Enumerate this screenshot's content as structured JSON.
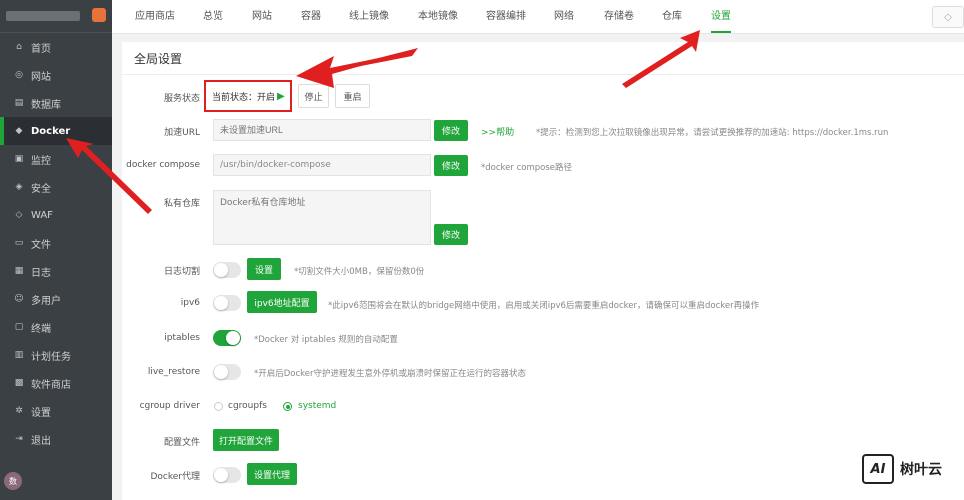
{
  "sidebar": {
    "items": [
      {
        "label": "首页",
        "icon": "home-icon",
        "glyph": "⌂"
      },
      {
        "label": "网站",
        "icon": "globe-icon",
        "glyph": "◎"
      },
      {
        "label": "数据库",
        "icon": "database-icon",
        "glyph": "▤"
      },
      {
        "label": "Docker",
        "icon": "docker-icon",
        "glyph": "◆",
        "active": true
      },
      {
        "label": "监控",
        "icon": "monitor-icon",
        "glyph": "▣"
      },
      {
        "label": "安全",
        "icon": "shield-icon",
        "glyph": "◈"
      },
      {
        "label": "WAF",
        "icon": "waf-shield-icon",
        "glyph": "◇"
      },
      {
        "label": "文件",
        "icon": "folder-icon",
        "glyph": "▭"
      },
      {
        "label": "日志",
        "icon": "log-icon",
        "glyph": "▦"
      },
      {
        "label": "多用户",
        "icon": "users-icon",
        "glyph": "☺"
      },
      {
        "label": "终端",
        "icon": "terminal-icon",
        "glyph": "▢"
      },
      {
        "label": "计划任务",
        "icon": "schedule-icon",
        "glyph": "▥"
      },
      {
        "label": "软件商店",
        "icon": "apps-icon",
        "glyph": "▩"
      },
      {
        "label": "设置",
        "icon": "gear-icon",
        "glyph": "✲"
      },
      {
        "label": "退出",
        "icon": "logout-icon",
        "glyph": "⇥"
      }
    ],
    "avatar_text": "数"
  },
  "tabs": [
    "应用商店",
    "总览",
    "网站",
    "容器",
    "线上镜像",
    "本地镜像",
    "容器编排",
    "网络",
    "存储卷",
    "仓库",
    "设置"
  ],
  "active_tab": "设置",
  "panel": {
    "title": "全局设置",
    "service_status": {
      "label": "服务状态",
      "status_text": "当前状态：开启",
      "stop_label": "停止",
      "restart_label": "重启"
    },
    "accel": {
      "label": "加速URL",
      "placeholder": "未设置加速URL",
      "button": "修改",
      "help": ">>帮助",
      "hint": "*提示：检测到您上次拉取镜像出现异常，请尝试更换推荐的加速站: https://docker.1ms.run"
    },
    "compose": {
      "label": "docker compose",
      "value": "/usr/bin/docker-compose",
      "button": "修改",
      "hint": "*docker compose路径"
    },
    "registry": {
      "label": "私有仓库",
      "placeholder": "Docker私有仓库地址",
      "button": "修改"
    },
    "log_cut": {
      "label": "日志切割",
      "button": "设置",
      "hint": "*切割文件大小0MB，保留份数0份"
    },
    "ipv6": {
      "label": "ipv6",
      "button": "ipv6地址配置",
      "hint": "*此ipv6范围将会在默认的bridge网络中使用，启用或关闭ipv6后需要重启docker，请确保可以重启docker再操作"
    },
    "iptables": {
      "label": "iptables",
      "hint": "*Docker 对 iptables 规则的自动配置"
    },
    "live_restore": {
      "label": "live_restore",
      "hint": "*开启后Docker守护进程发生意外停机或崩溃时保留正在运行的容器状态"
    },
    "cgroup": {
      "label": "cgroup driver",
      "option1": "cgroupfs",
      "option2": "systemd",
      "selected": "systemd"
    },
    "config_file": {
      "label": "配置文件",
      "button": "打开配置文件"
    },
    "proxy": {
      "label": "Docker代理",
      "button": "设置代理"
    }
  },
  "watermark": {
    "logo": "AI",
    "text": "树叶云"
  },
  "colors": {
    "accent": "#20a53a",
    "sidebar_bg": "#3b4045",
    "annotation": "#e02020"
  }
}
